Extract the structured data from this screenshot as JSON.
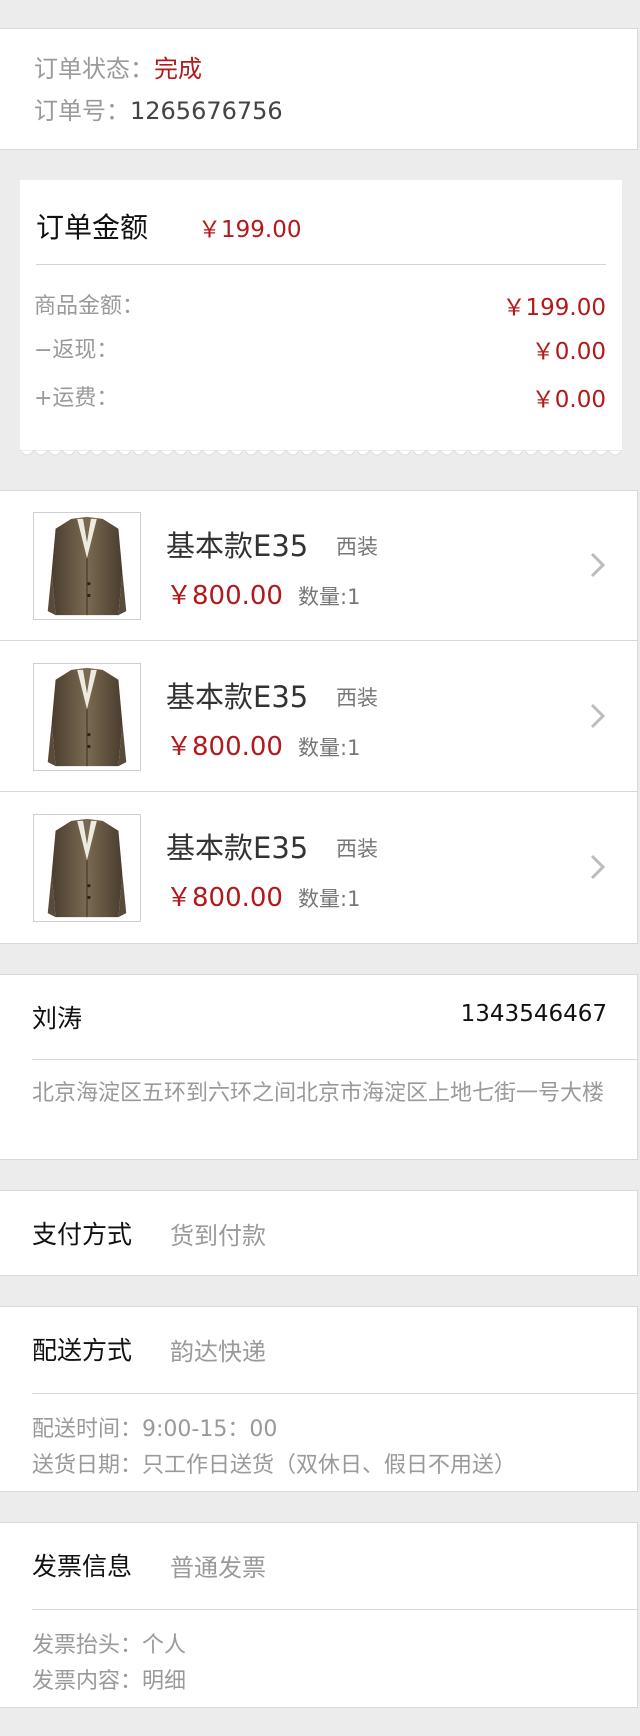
{
  "order_status": {
    "status_label": "订单状态：",
    "status_value": "完成",
    "number_label": "订单号：",
    "number_value": "1265676756"
  },
  "amount": {
    "title": "订单金额",
    "total": "￥199.00",
    "rows": [
      {
        "label": "商品金额：",
        "value": "￥199.00"
      },
      {
        "label": "−返现：",
        "value": "￥0.00"
      },
      {
        "label": "+运费：",
        "value": "￥0.00"
      }
    ]
  },
  "products": [
    {
      "name": "基本款E35",
      "category": "西装",
      "price": "￥800.00",
      "quantity": "数量:1"
    },
    {
      "name": "基本款E35",
      "category": "西装",
      "price": "￥800.00",
      "quantity": "数量:1"
    },
    {
      "name": "基本款E35",
      "category": "西装",
      "price": "￥800.00",
      "quantity": "数量:1"
    }
  ],
  "address": {
    "name": "刘涛",
    "phone": "1343546467",
    "detail": "北京海淀区五环到六环之间北京市海淀区上地七街一号大楼"
  },
  "payment": {
    "label": "支付方式",
    "value": "货到付款"
  },
  "delivery": {
    "label": "配送方式",
    "value": "韵达快递",
    "time": "配送时间：9:00-15：00",
    "date": "送货日期：只工作日送货（双休日、假日不用送）"
  },
  "invoice": {
    "label": "发票信息",
    "value": "普通发票",
    "header": "发票抬头：个人",
    "content": "发票内容：明细"
  },
  "colors": {
    "price_red": "#b3181c",
    "background": "#ececec"
  }
}
